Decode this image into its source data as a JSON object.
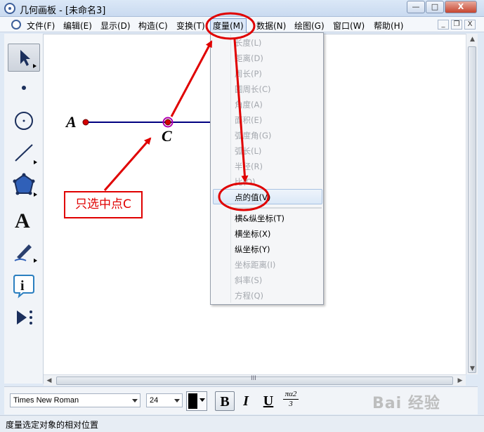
{
  "window": {
    "title": "几何画板 - [未命名3]",
    "minimize": "—",
    "maximize": "□",
    "close": "X"
  },
  "menubar": {
    "items": [
      "文件(F)",
      "编辑(E)",
      "显示(D)",
      "构造(C)",
      "变换(T)",
      "度量(M)",
      "数据(N)",
      "绘图(G)",
      "窗口(W)",
      "帮助(H)"
    ],
    "active_index": 5,
    "mdi_minimize": "_",
    "mdi_restore": "❐",
    "mdi_close": "X"
  },
  "toolbox": {
    "tools": [
      "arrow-tool-icon",
      "point-tool-icon",
      "compass-tool-icon",
      "straightedge-tool-icon",
      "polygon-tool-icon",
      "text-tool-icon",
      "marker-tool-icon",
      "information-tool-icon",
      "custom-tool-icon"
    ]
  },
  "canvas": {
    "point_a_label": "A",
    "point_c_label": "C",
    "callout": "只选中点C"
  },
  "measure_menu": {
    "items": [
      {
        "label": "长度(L)",
        "enabled": false
      },
      {
        "label": "距离(D)",
        "enabled": false
      },
      {
        "label": "周长(P)",
        "enabled": false
      },
      {
        "label": "圆周长(C)",
        "enabled": false
      },
      {
        "label": "角度(A)",
        "enabled": false
      },
      {
        "label": "面积(E)",
        "enabled": false
      },
      {
        "label": "弧度角(G)",
        "enabled": false
      },
      {
        "label": "弧长(L)",
        "enabled": false
      },
      {
        "label": "半径(R)",
        "enabled": false
      },
      {
        "label": "比(O)",
        "enabled": false
      },
      {
        "label": "点的值(V)",
        "enabled": true,
        "highlighted": true
      },
      {
        "label": "横&纵坐标(T)",
        "enabled": true
      },
      {
        "label": "横坐标(X)",
        "enabled": true
      },
      {
        "label": "纵坐标(Y)",
        "enabled": true
      },
      {
        "label": "坐标距离(I)",
        "enabled": false
      },
      {
        "label": "斜率(S)",
        "enabled": false
      },
      {
        "label": "方程(Q)",
        "enabled": false
      }
    ]
  },
  "format_bar": {
    "font": "Times New Roman",
    "size": "24",
    "bold": "B",
    "italic": "I",
    "underline": "U",
    "symbol_top": "πα2",
    "symbol_bottom": "3"
  },
  "status": {
    "text": "度量选定对象的相对位置"
  },
  "watermark": "Bai 经验",
  "colors": {
    "annotation_red": "#e00000",
    "segment_blue": "#000080",
    "point_red": "#d40000",
    "selection_magenta": "#b000b0"
  }
}
